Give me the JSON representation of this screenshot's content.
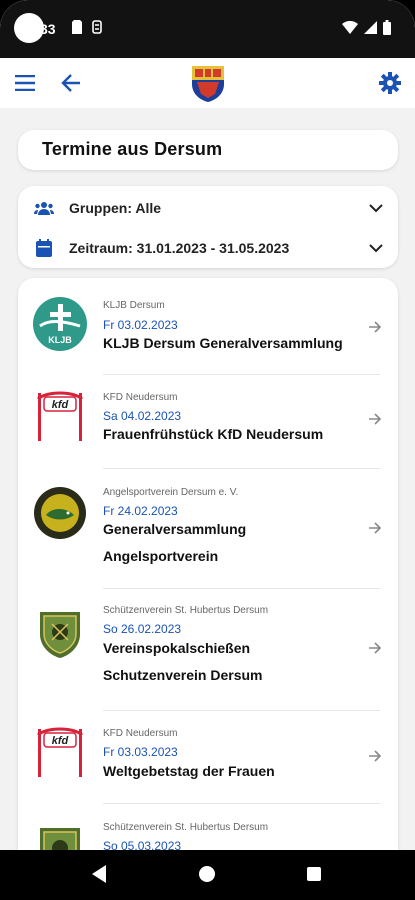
{
  "status_bar": {
    "time": "33",
    "icons": [
      "sd-card-icon",
      "storage-icon",
      "wifi-icon",
      "signal-icon",
      "battery-icon"
    ]
  },
  "app_bar": {
    "menu_icon": "menu-icon",
    "back_icon": "back-arrow-icon",
    "logo": "dersum-crest",
    "settings_icon": "gear-icon",
    "accent": "#1a53b3"
  },
  "page_title": "Termine aus Dersum",
  "filters": {
    "groups_label": "Gruppen: Alle",
    "period_label": "Zeitraum: 31.01.2023 - 31.05.2023"
  },
  "events": [
    {
      "org": "KLJB Dersum",
      "date": "Fr 03.02.2023",
      "title_lines": [
        "KLJB Dersum Generalversammlung"
      ],
      "logo": "kljb-logo"
    },
    {
      "org": "KFD Neudersum",
      "date": "Sa 04.02.2023",
      "title_lines": [
        "Frauenfrühstück KfD Neudersum"
      ],
      "logo": "kfd-logo"
    },
    {
      "org": "Angelsportverein Dersum e. V.",
      "date": "Fr 24.02.2023",
      "title_lines": [
        "Generalversammlung",
        "Angelsportverein"
      ],
      "logo": "angelsport-logo"
    },
    {
      "org": "Schützenverein St. Hubertus Dersum",
      "date": "So 26.02.2023",
      "title_lines": [
        "Vereinspokalschießen",
        "Schutzenverein Dersum"
      ],
      "logo": "schuetzen-logo"
    },
    {
      "org": "KFD Neudersum",
      "date": "Fr 03.03.2023",
      "title_lines": [
        "Weltgebetstag der Frauen"
      ],
      "logo": "kfd-logo"
    },
    {
      "org": "Schützenverein St. Hubertus Dersum",
      "date": "So 05.03.2023",
      "title_lines": [],
      "logo": "schuetzen-logo"
    }
  ],
  "logo_text": {
    "kljb": "KLJB",
    "kfd": "kfd"
  }
}
